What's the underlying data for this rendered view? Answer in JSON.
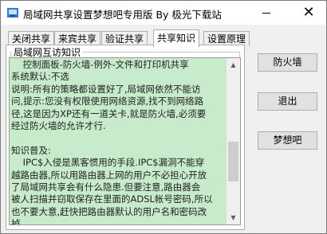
{
  "window": {
    "title": "局域网共享设置梦想吧专用版 By 极光下载站",
    "minimize_glyph": "",
    "close_glyph": "✕",
    "icon": "network-app-icon"
  },
  "tabs": [
    {
      "label": "关闭共享",
      "active": false
    },
    {
      "label": "来宾共享",
      "active": false
    },
    {
      "label": "验证共享",
      "active": false
    },
    {
      "label": "共享知识",
      "active": true
    },
    {
      "label": "设置原理",
      "active": false
    }
  ],
  "panel": {
    "group_label": "局域网互访知识",
    "text": "    控制面板-防火墙-例外-文件和打印机共享\n系统默认:不选\n说明:所有的策略都设置好了,局域网依然不能访\n问,提示:您没有权限使用网络资源,找不到网络路\n径,这是因为XP还有一道关卡,就是防火墙,必须要\n经过防火墙的允许才行.\n\n知识普及:\n    IPC$入侵是黑客惯用的手段.IPC$漏洞不能穿\n越路由器,所以用路由器上网的用户不必担心开放\n了局域网共享会有什么隐患.但要注意,路由器会\n被人扫描并窃取保存在里面的ADSL帐号密码,所以\n也不要大意,赶快把路由器默认的用户名和密码改\n掉.",
    "scroll_up_glyph": "▲",
    "scroll_down_glyph": "▼"
  },
  "buttons": {
    "firewall": "防火墙",
    "exit": "退出",
    "dreambar": "梦想吧"
  },
  "colors": {
    "text_bg": "#c7ebcb",
    "window_bg": "#f0f0f0"
  }
}
